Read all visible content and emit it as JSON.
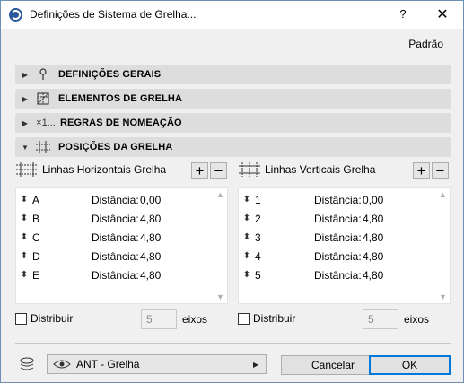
{
  "window": {
    "title": "Definições de Sistema de Grelha...",
    "help": "?",
    "close": "✕"
  },
  "preset": "Padrão",
  "sections": [
    {
      "label": "DEFINIÇÕES GERAIS",
      "expanded": false,
      "icon": "pin-icon"
    },
    {
      "label": "ELEMENTOS DE GRELHA",
      "expanded": false,
      "icon": "grid-element-icon"
    },
    {
      "label": "REGRAS DE NOMEAÇÃO",
      "expanded": false,
      "icon_text": "×1...",
      "icon": "naming-icon"
    },
    {
      "label": "POSIÇÕES DA GRELHA",
      "expanded": true,
      "icon": "grid-positions-icon"
    }
  ],
  "horizontal": {
    "title": "Linhas Horizontais Grelha",
    "add": "+",
    "remove": "−",
    "distance_label": "Distância:",
    "rows": [
      {
        "name": "A",
        "value": "0,00"
      },
      {
        "name": "B",
        "value": "4,80"
      },
      {
        "name": "C",
        "value": "4,80"
      },
      {
        "name": "D",
        "value": "4,80"
      },
      {
        "name": "E",
        "value": "4,80"
      }
    ],
    "distribute_label": "Distribuir",
    "count": "5",
    "axes_label": "eixos"
  },
  "vertical": {
    "title": "Linhas Verticais Grelha",
    "add": "+",
    "remove": "−",
    "distance_label": "Distância:",
    "rows": [
      {
        "name": "1",
        "value": "0,00"
      },
      {
        "name": "2",
        "value": "4,80"
      },
      {
        "name": "3",
        "value": "4,80"
      },
      {
        "name": "4",
        "value": "4,80"
      },
      {
        "name": "5",
        "value": "4,80"
      }
    ],
    "distribute_label": "Distribuir",
    "count": "5",
    "axes_label": "eixos"
  },
  "footer": {
    "layer": "ANT - Grelha",
    "cancel": "Cancelar",
    "ok": "OK"
  },
  "colors": {
    "accent": "#0078d7",
    "section_bg": "#dddddd",
    "app_icon": "#2b5a9c"
  }
}
